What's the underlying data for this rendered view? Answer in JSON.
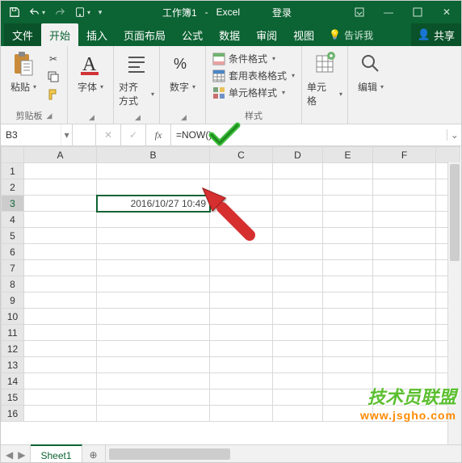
{
  "title": {
    "doc": "工作簿1",
    "app": "Excel",
    "login": "登录"
  },
  "tabs": {
    "file": "文件",
    "home": "开始",
    "insert": "插入",
    "layout": "页面布局",
    "formulas": "公式",
    "data": "数据",
    "review": "审阅",
    "view": "视图",
    "tell": "告诉我",
    "share": "共享"
  },
  "ribbon": {
    "clipboard": {
      "paste": "粘贴",
      "label": "剪贴板"
    },
    "font": {
      "btn": "字体"
    },
    "align": {
      "btn": "对齐方式"
    },
    "number": {
      "btn": "数字"
    },
    "styles": {
      "cond": "条件格式",
      "table": "套用表格格式",
      "cell": "单元格样式",
      "label": "样式"
    },
    "cells": {
      "btn": "单元格"
    },
    "editing": {
      "btn": "编辑"
    }
  },
  "fbar": {
    "cell": "B3",
    "formula": "=NOW()"
  },
  "cols": [
    "A",
    "B",
    "C",
    "D",
    "E",
    "F"
  ],
  "rows": [
    "1",
    "2",
    "3",
    "4",
    "5",
    "6",
    "7",
    "8",
    "9",
    "10",
    "11",
    "12",
    "13",
    "14",
    "15",
    "16"
  ],
  "cellB3": "2016/10/27 10:49",
  "sheet": {
    "name": "Sheet1"
  },
  "watermark": {
    "l1": "技术员联盟",
    "l2": "www.jsgho.com"
  }
}
